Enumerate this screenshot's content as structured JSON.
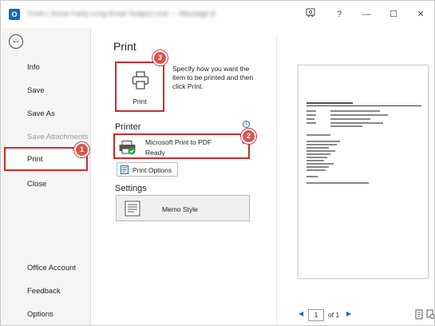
{
  "titlebar": {
    "app_icon_letter": "O",
    "title_blurred": "From | Some Fairly Long Email Subject Line — Message (HTML)",
    "buttons": [
      {
        "icon": "coauthor-icon",
        "glyph": "⚐"
      },
      {
        "icon": "help-icon",
        "glyph": "?"
      },
      {
        "icon": "minimize-icon",
        "glyph": "—"
      },
      {
        "icon": "maximize-icon",
        "glyph": "☐"
      },
      {
        "icon": "close-icon",
        "glyph": "✕"
      }
    ]
  },
  "nav": {
    "back_glyph": "←",
    "items": [
      {
        "label": "Info",
        "disabled": false
      },
      {
        "label": "Save",
        "disabled": false
      },
      {
        "label": "Save As",
        "disabled": false
      },
      {
        "label": "Save Attachments",
        "disabled": true
      },
      {
        "label": "Print",
        "disabled": false,
        "selected": true
      },
      {
        "label": "Close",
        "disabled": false
      }
    ],
    "bottom_items": [
      {
        "label": "Office Account"
      },
      {
        "label": "Feedback"
      },
      {
        "label": "Options"
      }
    ]
  },
  "main": {
    "heading": "Print",
    "print_button_label": "Print",
    "description": "Specify how you want the item to be printed and then click Print.",
    "printer_section": "Printer",
    "printer_name": "Microsoft Print to PDF",
    "printer_status": "Ready",
    "print_options_label": "Print Options",
    "settings_section": "Settings",
    "style_label": "Memo Style"
  },
  "callouts": [
    "1",
    "2",
    "3"
  ],
  "preview": {
    "page_current": "1",
    "page_total_label": "of 1"
  },
  "colors": {
    "highlight": "#cc2b2b",
    "badge": "#d9534f",
    "accent": "#0f6cbd"
  }
}
